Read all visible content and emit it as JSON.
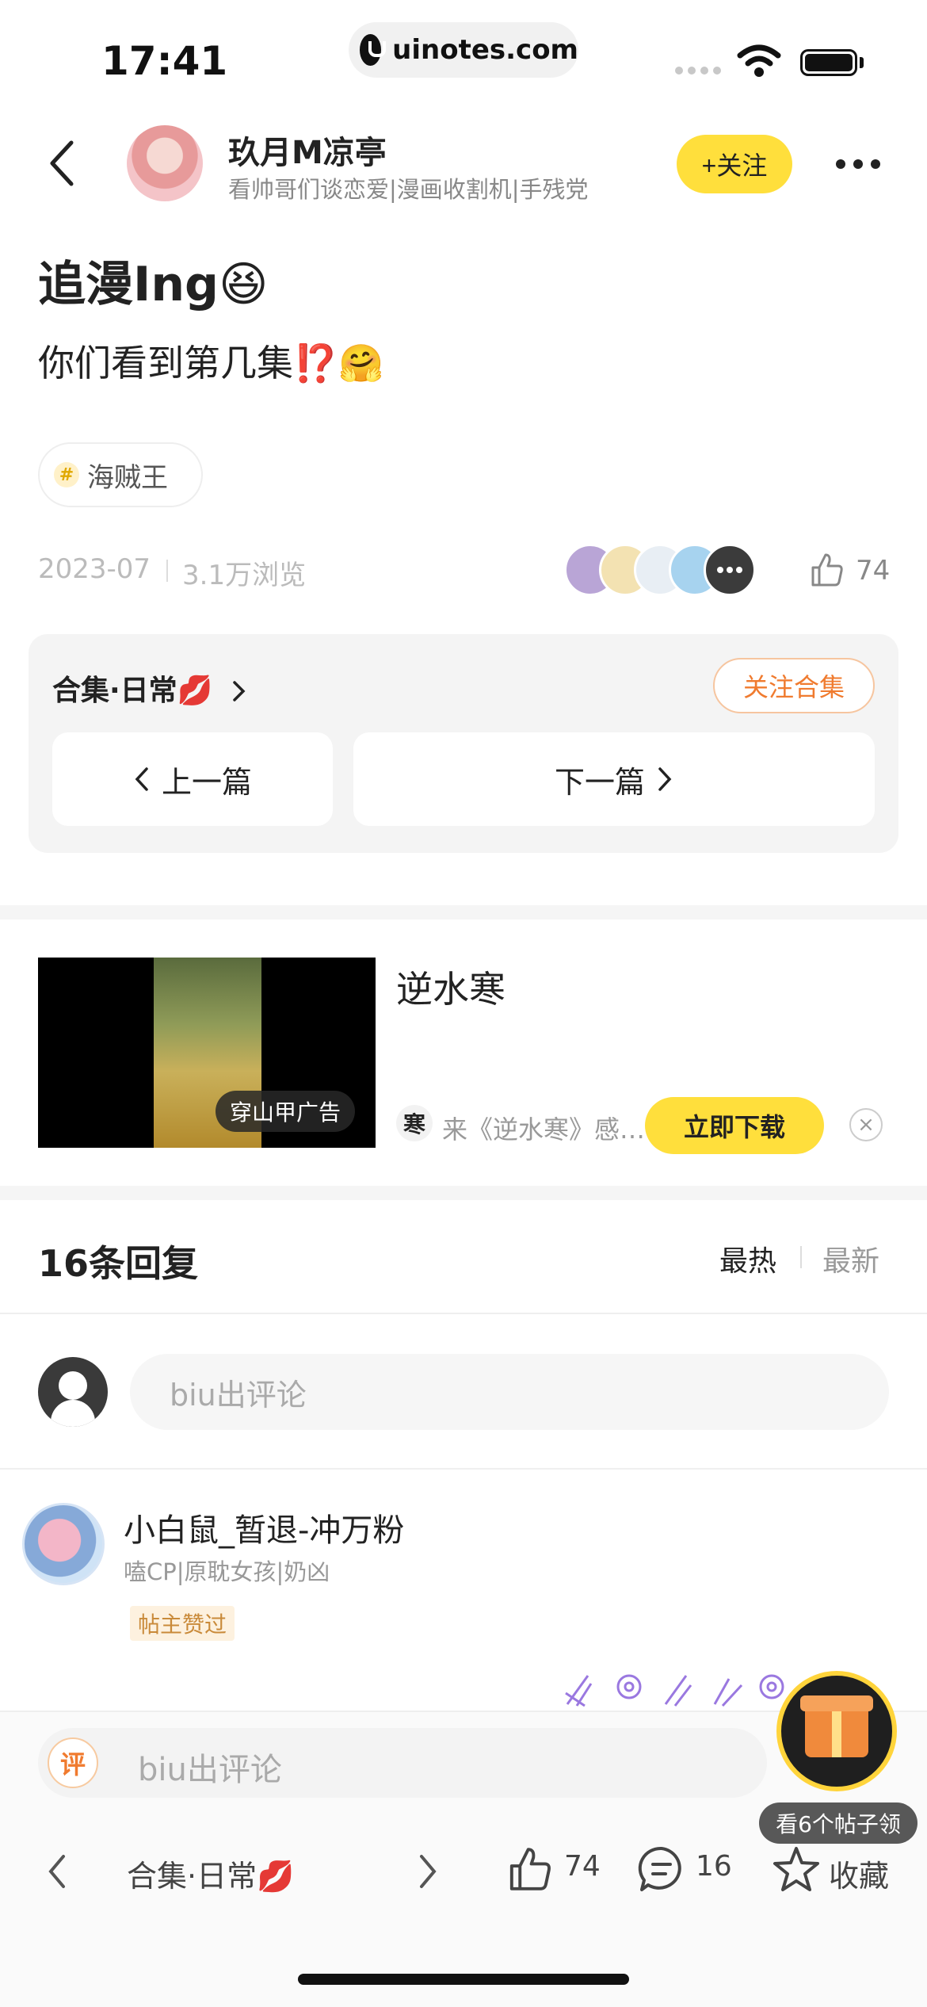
{
  "status_bar": {
    "time": "17:41",
    "url": "uinotes.com"
  },
  "header": {
    "author_name": "玖月M凉亭",
    "author_bio": "看帅哥们谈恋爱|漫画收割机|手残党",
    "follow_label": "+关注"
  },
  "post": {
    "title": "追漫Ing😆",
    "body": "你们看到第几集⁉️🤗",
    "tag": "海贼王",
    "date": "2023-07",
    "views": "3.1万浏览",
    "likes": "74"
  },
  "collection": {
    "title": "合集·日常💋",
    "follow_label": "关注合集",
    "prev_label": "上一篇",
    "next_label": "下一篇"
  },
  "ad": {
    "video_tag": "穿山甲广告",
    "title": "逆水寒",
    "source_logo": "寒",
    "source_text": "来《逆水寒》感…",
    "download_label": "立即下载",
    "close_icon": "×"
  },
  "replies": {
    "title": "16条回复",
    "sort_hot": "最热",
    "sort_new": "最新",
    "input_placeholder": "biu出评论"
  },
  "comments": [
    {
      "name": "小白鼠_暂退-冲万粉",
      "bio": "嗑CP|原耽女孩|奶凶",
      "badge": "帖主赞过"
    }
  ],
  "bottom_bar": {
    "input_icon": "评",
    "input_placeholder": "biu出评论",
    "collection_label": "合集·日常💋",
    "likes": "74",
    "comments": "16",
    "favorite_label": "收藏"
  },
  "floating": {
    "gift_label": "看6个帖子领"
  },
  "colors": {
    "accent_yellow": "#ffdf3c",
    "accent_orange": "#f07b2f"
  }
}
